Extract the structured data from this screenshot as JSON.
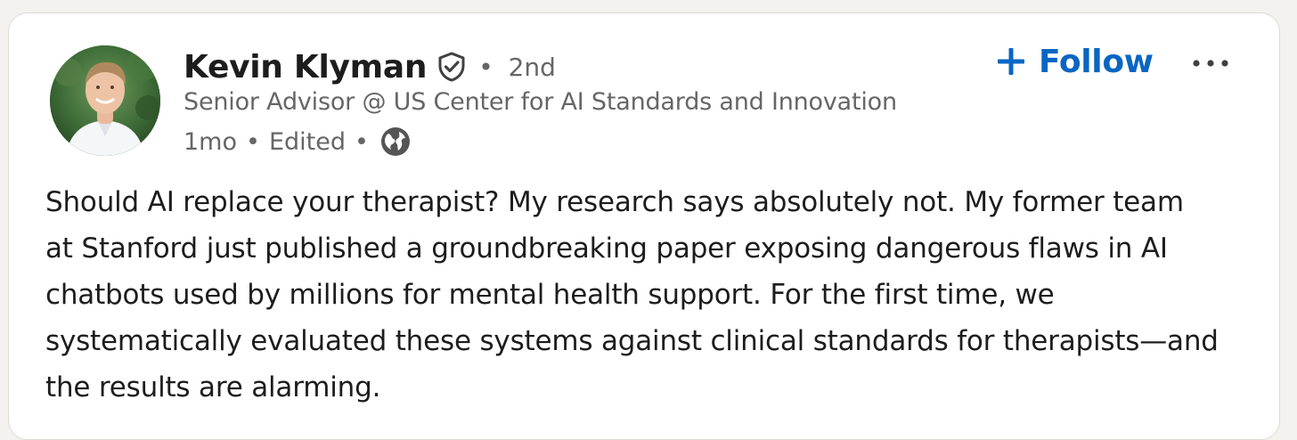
{
  "author": {
    "name": "Kevin Klyman",
    "connection_degree": "2nd",
    "headline": "Senior Advisor @ US Center for AI Standards and Innovation",
    "verified_icon": "verified-shield-icon"
  },
  "meta": {
    "time_ago": "1mo",
    "edited": "Edited",
    "separator": "•",
    "visibility_icon": "globe-icon"
  },
  "actions": {
    "follow_label": "Follow",
    "follow_icon": "plus-icon",
    "more_icon": "ellipsis-icon"
  },
  "post": {
    "lines": [
      "Should AI replace your therapist? My research says absolutely not. My former team",
      "at Stanford just published a groundbreaking paper exposing dangerous flaws in AI",
      "chatbots used by millions for mental health support. For the first time, we",
      "systematically evaluated these systems against clinical standards for therapists—and",
      "the results are alarming."
    ]
  },
  "colors": {
    "page_background": "#f3f2ee",
    "card_background": "#ffffff",
    "link_blue": "#0a66c2",
    "secondary_text": "#666666",
    "primary_text": "#1d1d1d"
  }
}
